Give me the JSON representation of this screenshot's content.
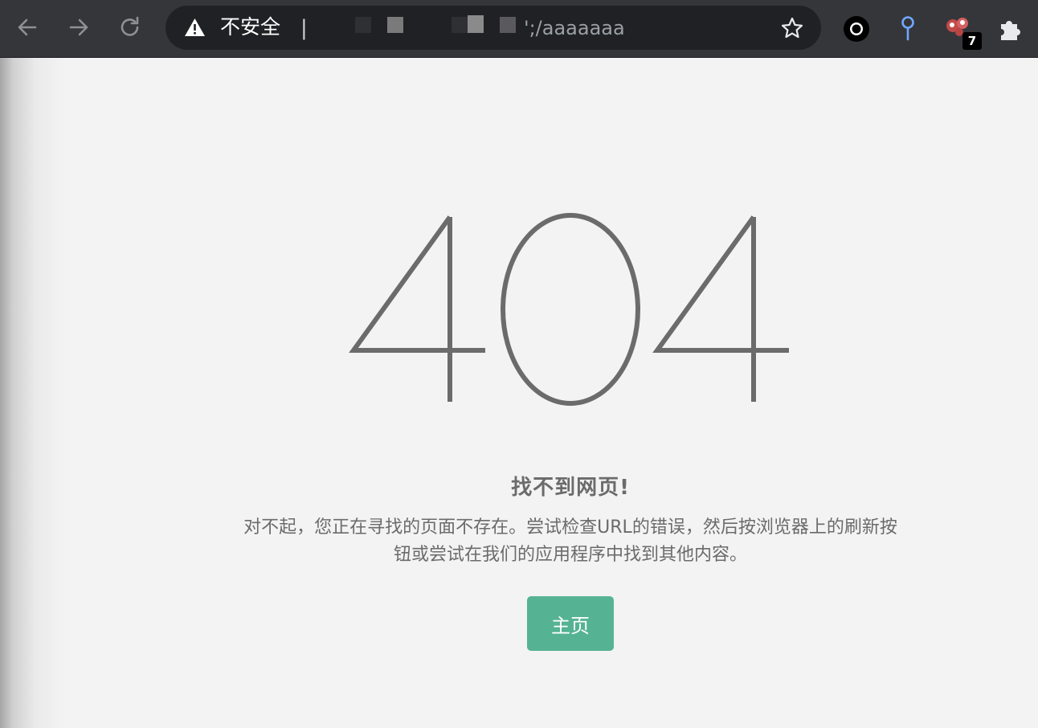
{
  "browser": {
    "security_label": "不安全",
    "url_suffix": "';/aaaaaaa",
    "extension_badge": "7"
  },
  "page": {
    "code": "404",
    "title": "找不到网页!",
    "description": "对不起，您正在寻找的页面不存在。尝试检查URL的错误，然后按浏览器上的刷新按钮或尝试在我们的应用程序中找到其他内容。",
    "home_button": "主页"
  },
  "colors": {
    "toolbar": "#35363a",
    "omnibox": "#202124",
    "page_background": "#f3f3f3",
    "text": "#6b6b6b",
    "button": "#55b393"
  }
}
